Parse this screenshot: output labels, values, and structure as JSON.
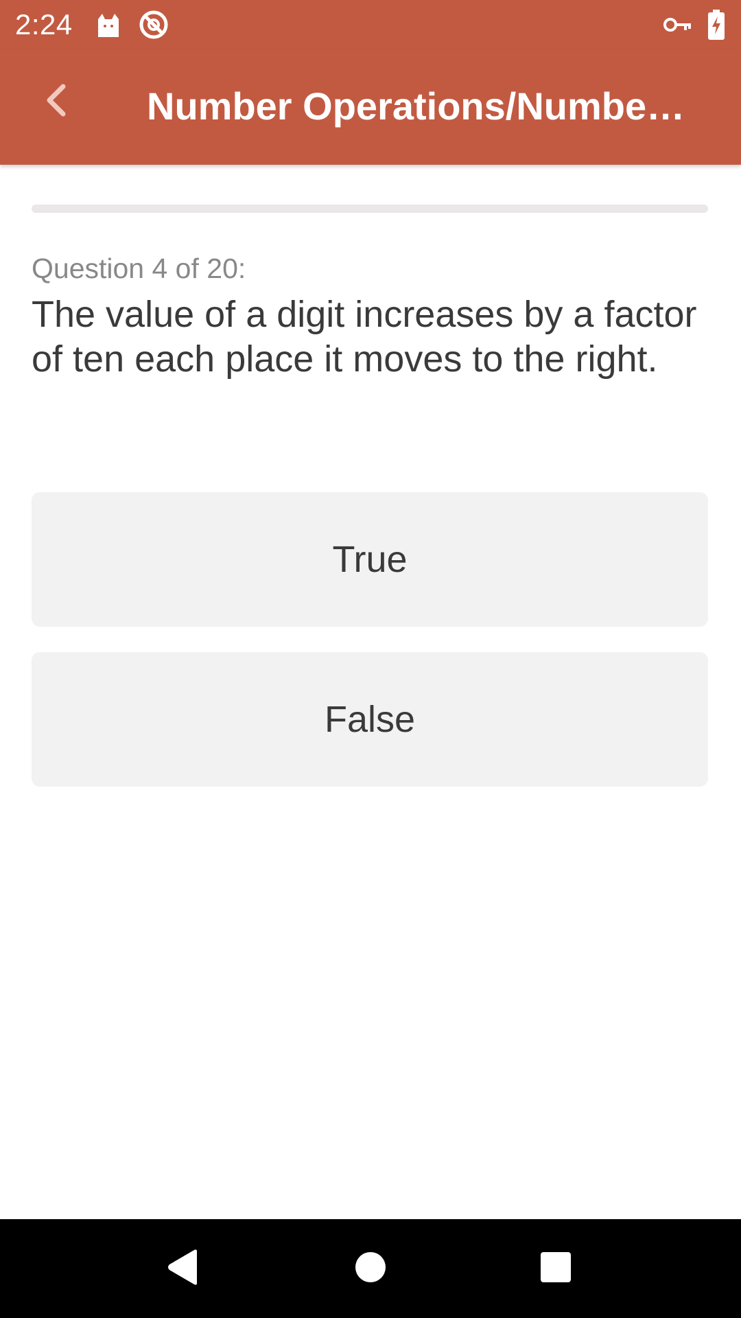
{
  "status_bar": {
    "time": "2:24",
    "icons": [
      "cat-notification-icon",
      "do-not-disturb-icon",
      "vpn-key-icon",
      "battery-charging-icon"
    ]
  },
  "app_bar": {
    "title": "Number Operations/Numbe…",
    "back_icon": "chevron-left-icon"
  },
  "progress": {
    "fraction": 0
  },
  "question": {
    "counter": "Question 4 of 20:",
    "text": "The value of a digit increases by a factor of ten each place it moves to the right."
  },
  "answers": [
    {
      "label": "True"
    },
    {
      "label": "False"
    }
  ],
  "nav_bar": {
    "icons": [
      "back-triangle-icon",
      "home-circle-icon",
      "recents-square-icon"
    ]
  },
  "colors": {
    "accent": "#c25a42",
    "answer_bg": "#f2f2f2",
    "text": "#3a3a3a",
    "muted_text": "#888888"
  }
}
